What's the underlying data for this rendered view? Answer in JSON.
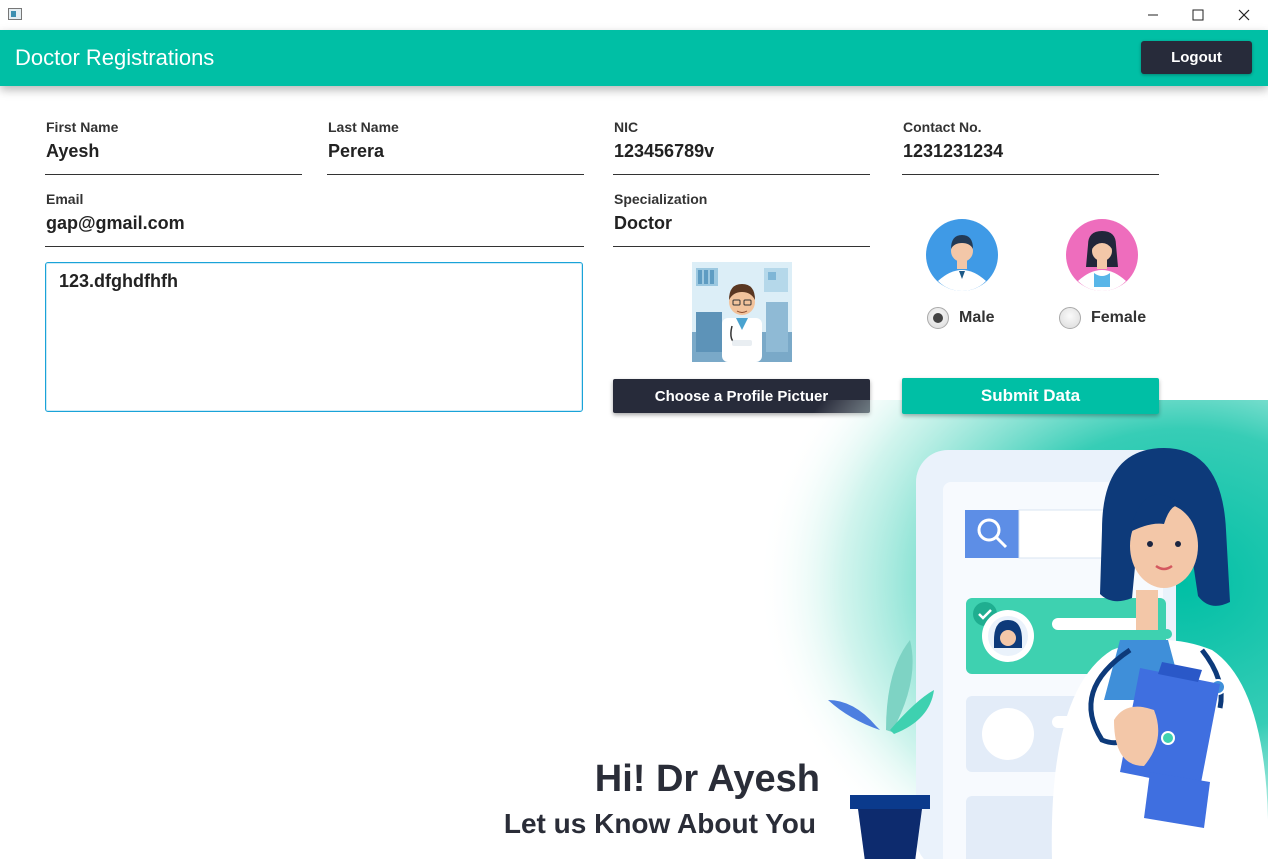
{
  "window": {
    "minimize": "—",
    "maximize": "☐",
    "close": "✕"
  },
  "header": {
    "title": "Doctor Registrations",
    "logout_label": "Logout"
  },
  "form": {
    "first_name": {
      "label": "First Name",
      "value": "Ayesh"
    },
    "last_name": {
      "label": "Last Name",
      "value": "Perera"
    },
    "nic": {
      "label": "NIC",
      "value": "123456789v"
    },
    "contact": {
      "label": "Contact No.",
      "value": "1231231234"
    },
    "email": {
      "label": "Email",
      "value": "gap@gmail.com"
    },
    "specialization": {
      "label": "Specialization",
      "value": "Doctor"
    },
    "address": {
      "value": "123.dfghdfhfh"
    }
  },
  "gender": {
    "male_label": "Male",
    "female_label": "Female",
    "selected": "Male"
  },
  "buttons": {
    "choose_picture": "Choose a Profile Pictuer",
    "submit": "Submit Data"
  },
  "greeting": {
    "title": "Hi! Dr Ayesh",
    "subtitle": "Let us Know About You"
  },
  "colors": {
    "accent": "#00bfa5",
    "dark": "#272b3a",
    "focus_border": "#1aa3d8"
  },
  "icons": {
    "app": "app-window-icon",
    "male": "male-doctor-avatar-icon",
    "female": "female-doctor-avatar-icon",
    "search": "search-icon",
    "check": "check-icon"
  }
}
